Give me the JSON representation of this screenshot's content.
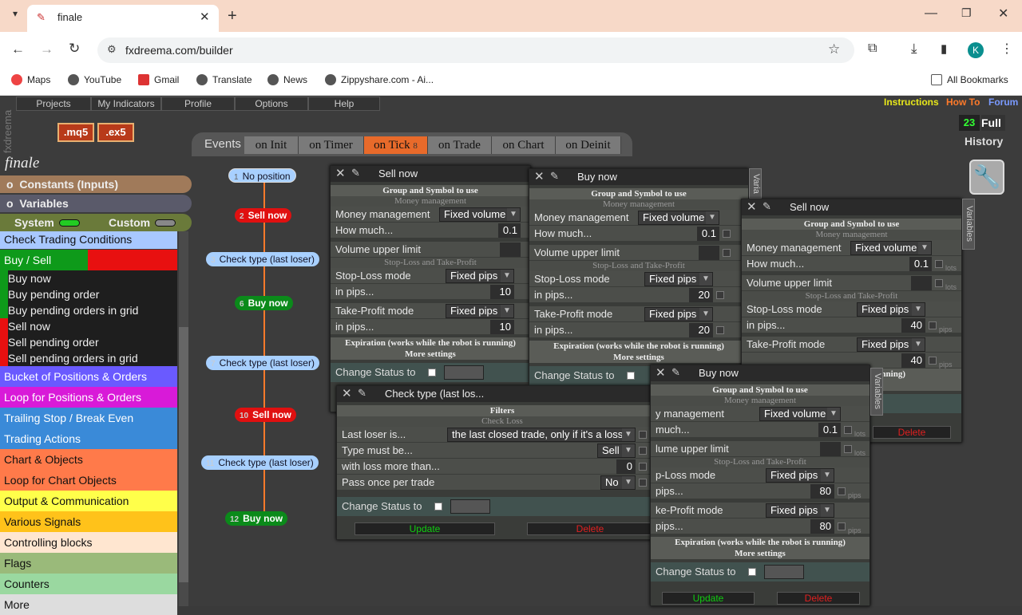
{
  "browser": {
    "tab_title": "finale",
    "url": "fxdreema.com/builder",
    "bookmarks": [
      "Maps",
      "YouTube",
      "Gmail",
      "Translate",
      "News",
      "Zippyshare.com - Ai...",
      "All Bookmarks"
    ],
    "profile_initial": "K"
  },
  "app": {
    "side_label": "fxdreema",
    "project_name": "finale",
    "menu": [
      "Projects",
      "My Indicators",
      "Profile",
      "Options",
      "Help"
    ],
    "top_links": [
      "Instructions",
      "How To",
      "Forum"
    ],
    "formats": [
      ".mq5",
      ".ex5"
    ],
    "history_count": "23",
    "full_label": "Full",
    "history_label": "History",
    "constants_label": "Constants (Inputs)",
    "variables_label": "Variables",
    "counter_o": "o",
    "system_label": "System",
    "custom_label": "Custom",
    "categories": [
      "Check Trading Conditions",
      "Buy / Sell",
      "Bucket of Positions & Orders",
      "Loop for Positions & Orders",
      "Trailing Stop / Break Even",
      "Trading Actions",
      "Chart & Objects",
      "Loop for Chart Objects",
      "Output & Communication",
      "Various Signals",
      "Controlling blocks",
      "Flags",
      "Counters",
      "More"
    ],
    "buysell_items": [
      "Buy now",
      "Buy pending order",
      "Buy pending orders in grid",
      "Sell now",
      "Sell pending order",
      "Sell pending orders in grid"
    ],
    "events_label": "Events",
    "event_tabs": [
      "on Init",
      "on Timer",
      "on Tick",
      "on Trade",
      "on Chart",
      "on Deinit"
    ],
    "active_tab_badge": "8"
  },
  "nodes": [
    {
      "n": "1",
      "label": "No position"
    },
    {
      "n": "2",
      "label": "Sell now"
    },
    {
      "n": "3",
      "label": "Check type (last loser)"
    },
    {
      "n": "6",
      "label": "Buy now"
    },
    {
      "n": "7",
      "label": "Check type (last loser)"
    },
    {
      "n": "10",
      "label": "Sell now"
    },
    {
      "n": "11",
      "label": "Check type (last loser)"
    },
    {
      "n": "12",
      "label": "Buy now"
    }
  ],
  "labels": {
    "group": "Group and Symbol to use",
    "money": "Money management",
    "money_mode": "Money management",
    "how_much": "How much...",
    "vol_limit": "Volume upper limit",
    "sltp": "Stop-Loss and Take-Profit",
    "sl_mode": "Stop-Loss mode",
    "in_pips": "in pips...",
    "tp_mode": "Take-Profit mode",
    "expiration": "Expiration (works while the robot is running)",
    "more": "More settings",
    "change_status": "Change Status to",
    "update": "Update",
    "delete": "Delete",
    "fixed_volume": "Fixed volume",
    "fixed_pips": "Fixed pips",
    "variables": "Variables",
    "lots": "lots",
    "pips": "pips",
    "q": "?",
    "v_trunc": "Varia",
    "filters": "Filters",
    "check_loss": "Check Loss",
    "last_loser": "Last loser is...",
    "last_loser_val": "the last closed trade, only if it's a loss",
    "type_must": "Type must be...",
    "type_val": "Sell",
    "loss_more": "with loss more than...",
    "loss_val": "0",
    "pass_once": "Pass once per trade",
    "pass_val": "No",
    "ct_title": "Check type (last los...",
    "vert_var": "Variables"
  },
  "panels": {
    "sell1": {
      "title": "Sell now",
      "how": "0.1",
      "sl": "10",
      "tp": "10"
    },
    "buy1": {
      "title": "Buy now",
      "how": "0.1",
      "sl": "20",
      "tp": "20"
    },
    "sell2": {
      "title": "Sell now",
      "how": "0.1",
      "sl": "40",
      "tp": "40",
      "exp_trunc": "bot is running)"
    },
    "buy2": {
      "title": "Buy now",
      "how": "0.1",
      "sl": "80",
      "tp": "80",
      "money_trunc": "y management",
      "how_trunc": "much...",
      "vol_trunc": "lume upper limit",
      "sl_trunc": "p-Loss mode",
      "pips_trunc": "pips...",
      "tp_trunc": "ke-Profit mode",
      "pips2_trunc": "pips..."
    }
  },
  "colors": {
    "buy": "#0b8a1a",
    "sell": "#e01010",
    "wire": "#ff7a2a",
    "active_tab": "#e86a2a"
  }
}
